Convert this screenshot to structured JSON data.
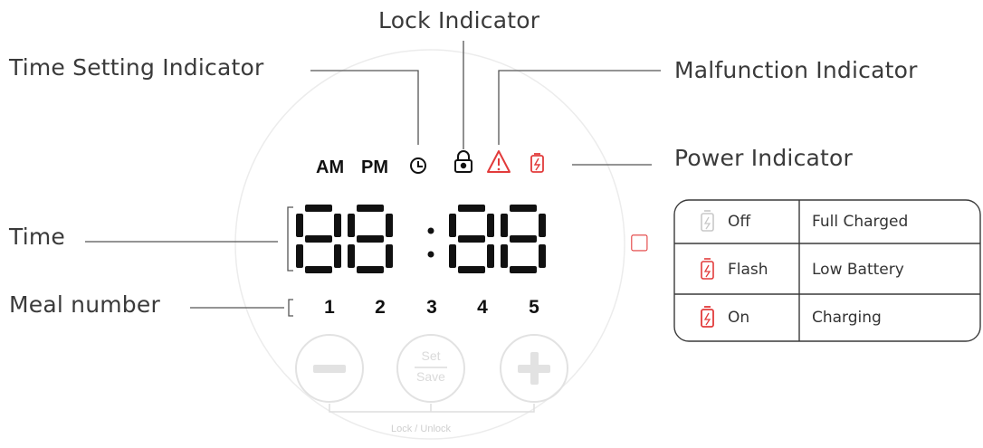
{
  "labels": {
    "lock": "Lock Indicator",
    "time_setting": "Time Setting Indicator",
    "malfunction": "Malfunction Indicator",
    "power": "Power Indicator",
    "time": "Time",
    "meal": "Meal number"
  },
  "display": {
    "am": "AM",
    "pm": "PM",
    "meals": [
      "1",
      "2",
      "3",
      "4",
      "5"
    ]
  },
  "buttons": {
    "set_top": "Set",
    "set_bottom": "Save",
    "lock_unlock": "Lock / Unlock"
  },
  "power_table": [
    {
      "status": "Off",
      "meaning": "Full Charged",
      "icon_color": "#c8c8c8"
    },
    {
      "status": "Flash",
      "meaning": "Low Battery",
      "icon_color": "#e23b3b"
    },
    {
      "status": "On",
      "meaning": "Charging",
      "icon_color": "#e23b3b"
    }
  ],
  "colors": {
    "alert": "#e23b3b",
    "segment": "#111111",
    "faint": "#e2e2e2"
  }
}
